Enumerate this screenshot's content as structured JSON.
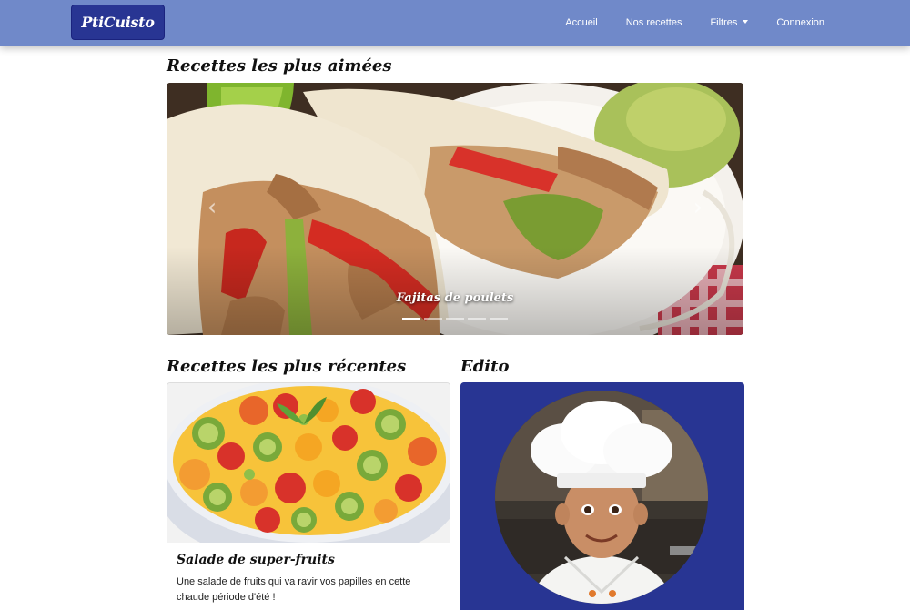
{
  "navbar": {
    "brand": "PtiCuisto",
    "links": {
      "home": "Accueil",
      "recipes": "Nos recettes",
      "filters": "Filtres",
      "login": "Connexion"
    }
  },
  "popular": {
    "heading": "Recettes les plus aimées",
    "caption": "Fajitas de poulets",
    "slide_count": 5,
    "active_slide": 1
  },
  "recent": {
    "heading": "Recettes les plus récentes",
    "card_title": "Salade de super-fruits",
    "card_text": "Une salade de fruits qui va ravir vos papilles en cette chaude période d'été !"
  },
  "edito": {
    "heading": "Edito"
  },
  "colors": {
    "navbar": "#7089c9",
    "brand_bg": "#283593",
    "edito_bg": "#283593"
  }
}
